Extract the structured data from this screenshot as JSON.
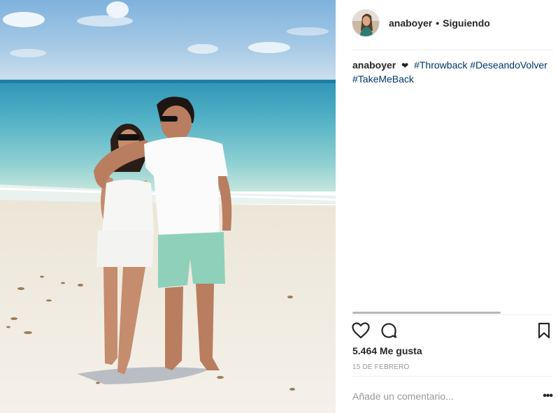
{
  "post": {
    "username": "anaboyer",
    "separator": "•",
    "follow_status": "Siguiendo",
    "caption": {
      "username": "anaboyer",
      "emoji": "❤",
      "hashtags": [
        "#Throwback",
        "#DeseandoVolver",
        "#TakeMeBack"
      ]
    },
    "likes": "5.464 Me gusta",
    "date": "15 DE FEBRERO",
    "comment_placeholder": "Añade un comentario...",
    "more_label": "•••"
  },
  "icons": {
    "like": "heart-outline-icon",
    "comment": "speech-bubble-icon",
    "save": "bookmark-icon",
    "more": "more-options-icon"
  },
  "colors": {
    "text": "#262626",
    "hashtag": "#003569",
    "muted": "#999999",
    "divider": "#efefef"
  }
}
